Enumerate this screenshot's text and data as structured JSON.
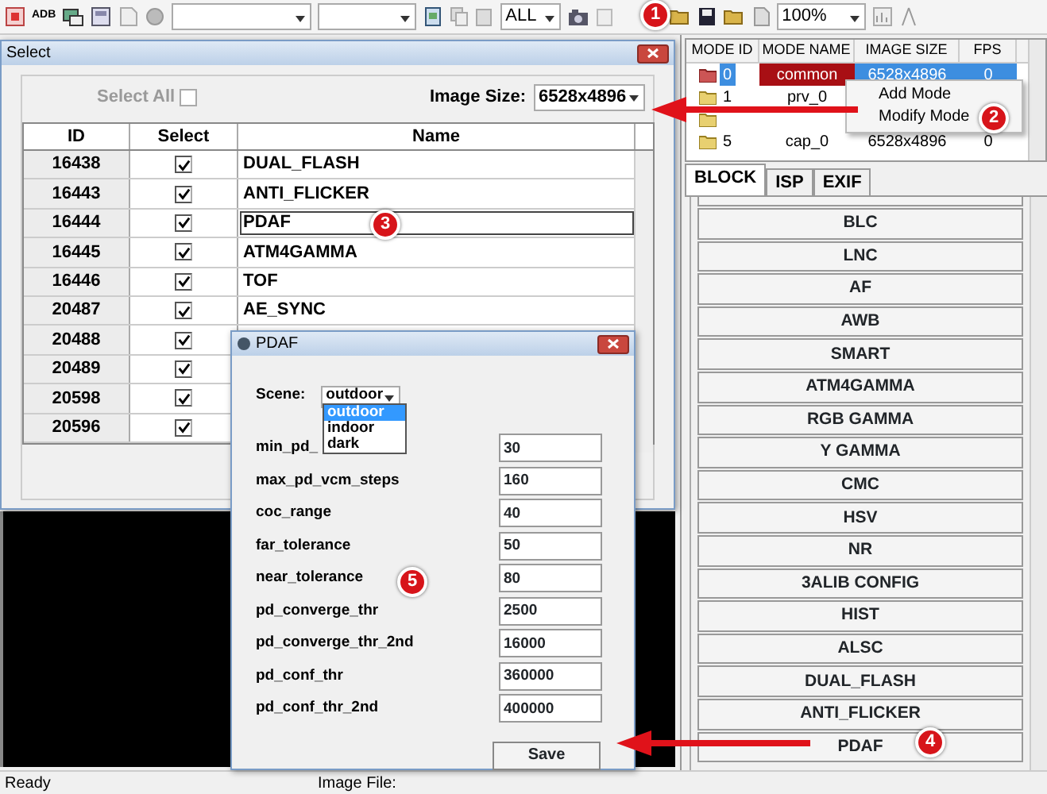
{
  "toolbar": {
    "adb_label": "ADB",
    "filter_combo": "ALL",
    "zoom_combo": "100%"
  },
  "select_dialog": {
    "title": "Select",
    "select_all": {
      "label": "Select All",
      "checked": false,
      "disabled": true
    },
    "image_size_label": "Image Size:",
    "image_size": "6528x4896",
    "columns": [
      "ID",
      "Select",
      "Name"
    ],
    "rows": [
      {
        "id": "16438",
        "checked": true,
        "name": "DUAL_FLASH",
        "selected": false
      },
      {
        "id": "16443",
        "checked": true,
        "name": "ANTI_FLICKER",
        "selected": false
      },
      {
        "id": "16444",
        "checked": true,
        "name": "PDAF",
        "selected": true
      },
      {
        "id": "16445",
        "checked": true,
        "name": "ATM4GAMMA",
        "selected": false
      },
      {
        "id": "16446",
        "checked": true,
        "name": "TOF",
        "selected": false
      },
      {
        "id": "20487",
        "checked": true,
        "name": "AE_SYNC",
        "selected": false
      },
      {
        "id": "20488",
        "checked": true,
        "selected": false
      },
      {
        "id": "20489",
        "checked": true
      },
      {
        "id": "20598",
        "checked": true
      },
      {
        "id": "20596",
        "checked": true
      }
    ]
  },
  "pdaf_dialog": {
    "title": "PDAF",
    "scene_label": "Scene:",
    "scene": "outdoor",
    "scene_options": [
      {
        "label": "outdoor",
        "selected": true
      },
      {
        "label": "indoor",
        "selected": false
      },
      {
        "label": "dark",
        "selected": false
      }
    ],
    "params": [
      {
        "label": "min_pd_",
        "value": "30"
      },
      {
        "label": "max_pd_vcm_steps",
        "value": "160"
      },
      {
        "label": "coc_range",
        "value": "40"
      },
      {
        "label": "far_tolerance",
        "value": "50"
      },
      {
        "label": "near_tolerance",
        "value": "80"
      },
      {
        "label": "pd_converge_thr",
        "value": "2500"
      },
      {
        "label": "pd_converge_thr_2nd",
        "value": "16000"
      },
      {
        "label": "pd_conf_thr",
        "value": "360000"
      },
      {
        "label": "pd_conf_thr_2nd",
        "value": "400000"
      }
    ],
    "save": "Save"
  },
  "mode_table": {
    "columns": [
      "MODE ID",
      "MODE NAME",
      "IMAGE SIZE",
      "FPS"
    ],
    "rows": [
      {
        "id": "0",
        "name": "common",
        "size": "6528x4896",
        "fps": "0",
        "selected": true
      },
      {
        "id": "1",
        "name": "prv_0",
        "selected": false
      },
      {},
      {
        "id": "5",
        "name": "cap_0",
        "size": "6528x4896",
        "fps": "0",
        "selected": false
      }
    ]
  },
  "context_menu": [
    "Add Mode",
    "Modify Mode"
  ],
  "block_tabs": [
    {
      "label": "BLOCK",
      "selected": true
    },
    {
      "label": "ISP",
      "selected": false
    },
    {
      "label": "EXIF",
      "selected": false
    }
  ],
  "blocks": [
    "BLC",
    "LNC",
    "AF",
    "AWB",
    "SMART",
    "ATM4GAMMA",
    "RGB GAMMA",
    "Y GAMMA",
    "CMC",
    "HSV",
    "NR",
    "3ALIB CONFIG",
    "HIST",
    "ALSC",
    "DUAL_FLASH",
    "ANTI_FLICKER",
    "PDAF"
  ],
  "status_bar": {
    "message": "Ready",
    "image_file_label": "Image File:"
  },
  "annotations": [
    "1",
    "2",
    "3",
    "4",
    "5"
  ]
}
